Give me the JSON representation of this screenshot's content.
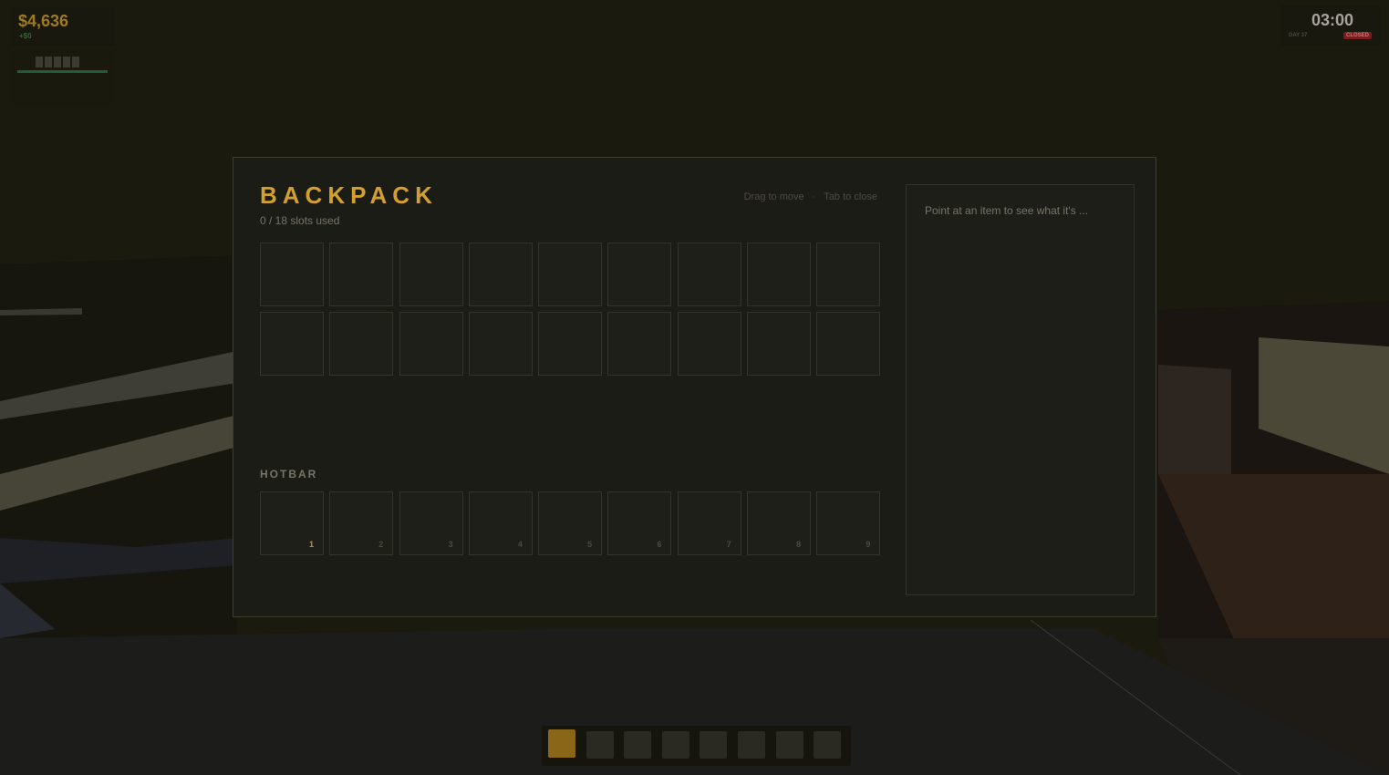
{
  "hud": {
    "money": "$4,636",
    "money_delta": "+$0",
    "stamina_segments": 5,
    "clock_time": "03:00",
    "day_label": "DAY 37",
    "shop_status": "CLOSED"
  },
  "backpack": {
    "title": "BACKPACK",
    "slots_used": "0 / 18 slots used",
    "hint_move": "Drag to move",
    "hint_sep": "·",
    "hint_close": "Tab to close",
    "hotbar_label": "HOTBAR",
    "main_slot_count": 18,
    "hotbar_numbers": [
      "1",
      "2",
      "3",
      "4",
      "5",
      "6",
      "7",
      "8",
      "9"
    ],
    "active_hotbar_slot": 1,
    "details_placeholder": "Point at an item to see what it's ..."
  },
  "quickbar": {
    "slot_count": 8,
    "active_slot": 1
  },
  "colors": {
    "accent": "#d1a030",
    "status_closed": "#7a1c1c",
    "money": "#a07a1c"
  }
}
